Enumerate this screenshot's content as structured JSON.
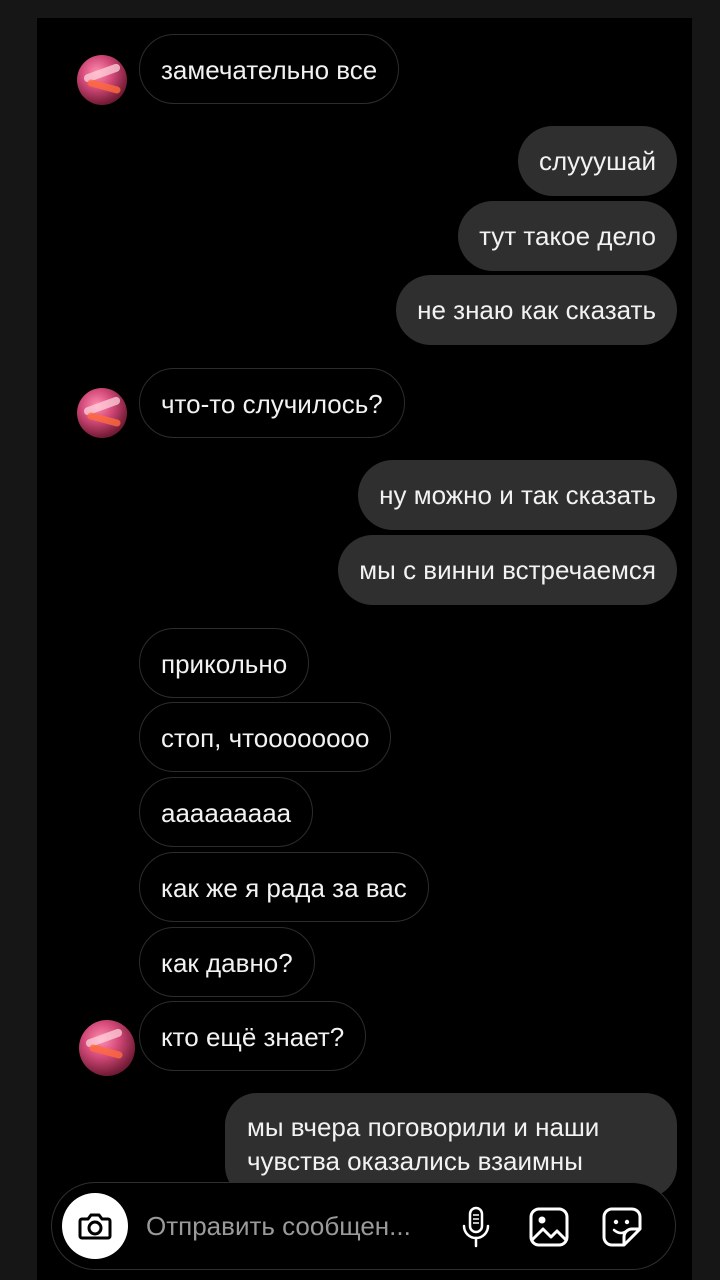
{
  "messages": [
    {
      "side": "in",
      "text": "замечательно все"
    },
    {
      "side": "out",
      "text": "слууушай"
    },
    {
      "side": "out",
      "text": "тут такое дело"
    },
    {
      "side": "out",
      "text": "не знаю как сказать"
    },
    {
      "side": "in",
      "text": "что-то случилось?"
    },
    {
      "side": "out",
      "text": "ну можно и так сказать"
    },
    {
      "side": "out",
      "text": "мы с винни встречаемся"
    },
    {
      "side": "in",
      "text": "прикольно"
    },
    {
      "side": "in",
      "text": "стоп, чтооооoooo"
    },
    {
      "side": "in",
      "text": "ааааааааа"
    },
    {
      "side": "in",
      "text": "как же я рада за вас"
    },
    {
      "side": "in",
      "text": "как давно?"
    },
    {
      "side": "in",
      "text": "кто ещё знает?"
    },
    {
      "side": "out",
      "text": "мы вчера поговорили и наши чувства оказались взаимны"
    }
  ],
  "composer": {
    "placeholder": "Отправить сообщен..."
  },
  "icons": {
    "camera": "camera-icon",
    "mic": "microphone-icon",
    "gallery": "gallery-icon",
    "sticker": "sticker-icon"
  },
  "colors": {
    "background": "#000000",
    "outgoing_bubble": "#2f2f2f",
    "incoming_border": "#2c2c2c",
    "text": "#f2f2f2",
    "placeholder": "#9a9a9a"
  }
}
